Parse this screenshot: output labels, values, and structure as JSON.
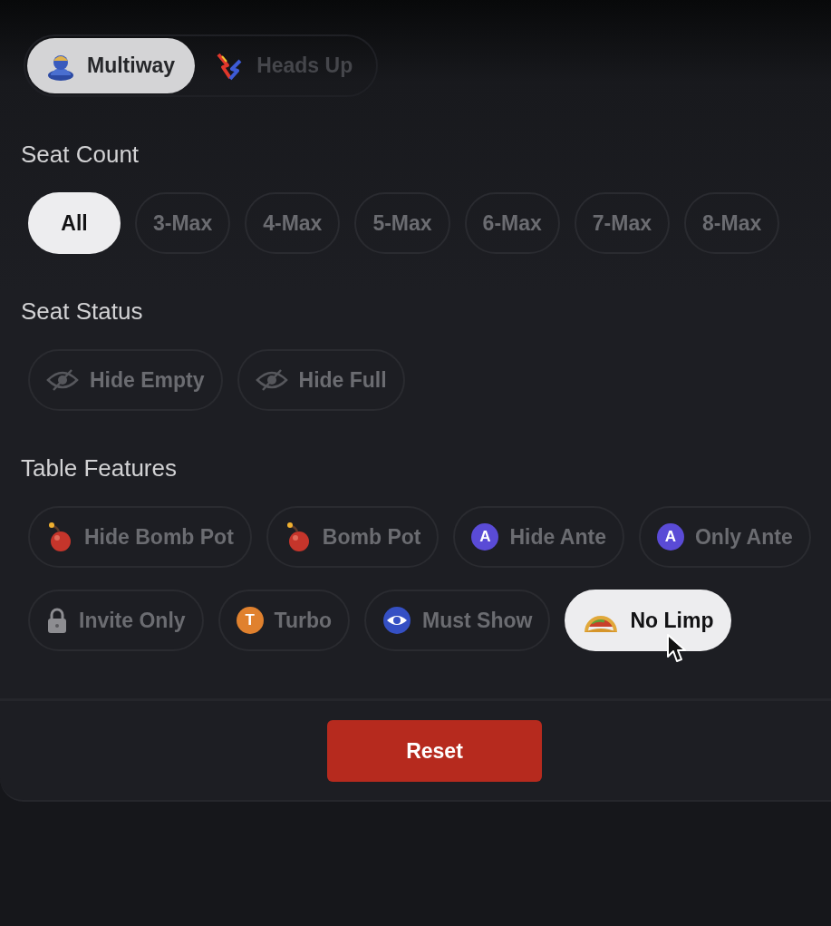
{
  "mode_toggle": [
    {
      "label": "Multiway",
      "kind": "group",
      "selected": true
    },
    {
      "label": "Heads Up",
      "kind": "versus",
      "selected": false
    }
  ],
  "sections": [
    {
      "title": "Seat Count",
      "rows": [
        [
          {
            "label": "All",
            "selected": true
          },
          {
            "label": "3-Max",
            "selected": false
          },
          {
            "label": "4-Max",
            "selected": false
          },
          {
            "label": "5-Max",
            "selected": false
          },
          {
            "label": "6-Max",
            "selected": false
          },
          {
            "label": "7-Max",
            "selected": false
          },
          {
            "label": "8-Max",
            "selected": false
          }
        ]
      ]
    },
    {
      "title": "Seat Status",
      "rows": [
        [
          {
            "label": "Hide Empty",
            "kind": "eye_off",
            "selected": false
          },
          {
            "label": "Hide Full",
            "kind": "eye_off",
            "selected": false
          }
        ]
      ]
    },
    {
      "title": "Table Features",
      "rows": [
        [
          {
            "label": "Hide Bomb Pot",
            "kind": "bomb",
            "selected": false,
            "hovered": false
          },
          {
            "label": "Bomb Pot",
            "kind": "bomb",
            "selected": false,
            "hovered": false
          },
          {
            "label": "Hide Ante",
            "kind": "letter",
            "badge": "A",
            "color": "#5a4bd6",
            "selected": false,
            "hovered": false
          },
          {
            "label": "Only Ante",
            "kind": "letter",
            "badge": "A",
            "color": "#5a4bd6",
            "selected": false,
            "hovered": false
          }
        ],
        [
          {
            "label": "Invite Only",
            "kind": "lock",
            "selected": false,
            "hovered": false
          },
          {
            "label": "Turbo",
            "kind": "letter",
            "badge": "T",
            "color": "#e0812e",
            "selected": false,
            "hovered": false
          },
          {
            "label": "Must Show",
            "kind": "eye",
            "selected": false,
            "hovered": false
          },
          {
            "label": "No Limp",
            "kind": "taco",
            "selected": true,
            "hovered": true
          }
        ]
      ]
    }
  ],
  "reset_button": {
    "label": "Reset"
  }
}
